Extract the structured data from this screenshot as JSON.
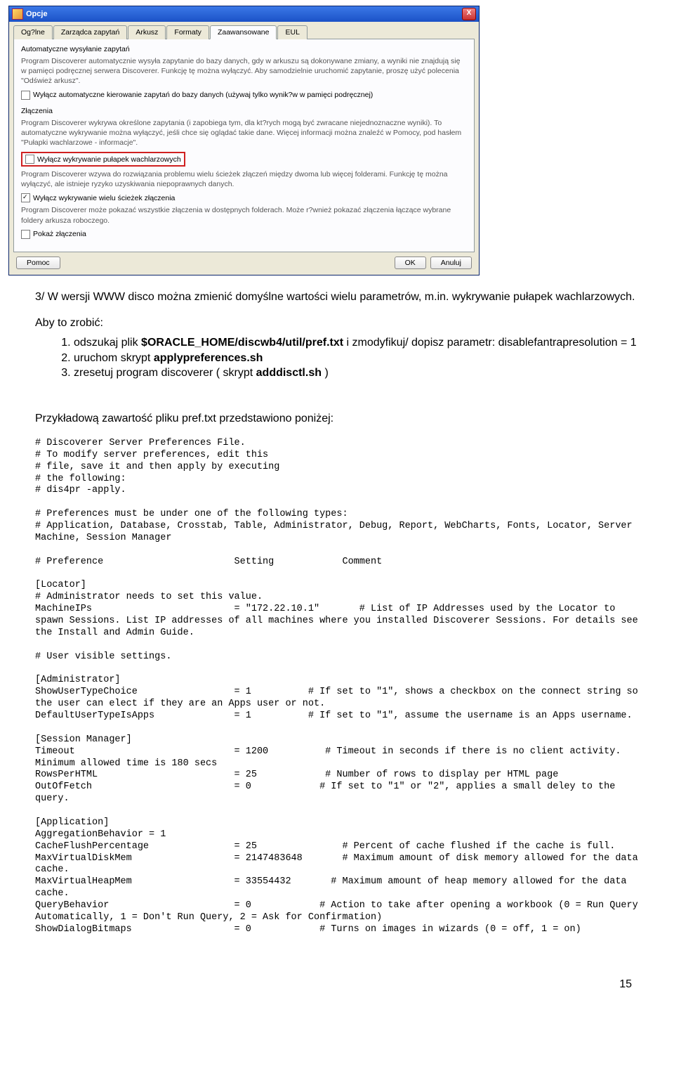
{
  "dialog": {
    "title": "Opcje",
    "tabs": [
      "Og?lne",
      "Zarządca zapytań",
      "Arkusz",
      "Formaty",
      "Zaawansowane",
      "EUL"
    ],
    "active_tab": 4,
    "group1_title": "Automatyczne wysyłanie zapytań",
    "group1_desc": "Program Discoverer automatycznie wysyła zapytanie do bazy danych, gdy w arkuszu są dokonywane zmiany, a wyniki nie znajdują się w pamięci podręcznej serwera Discoverer. Funkcję tę można wyłączyć. Aby samodzielnie uruchomić zapytanie, proszę użyć polecenia \"Odśwież arkusz\".",
    "chk1_label": "Wyłącz automatyczne kierowanie zapytań do bazy danych (używaj tylko wynik?w w pamięci podręcznej)",
    "group2_title": "Złączenia",
    "group2_desc1": "Program Discoverer wykrywa określone zapytania (i zapobiega tym, dla kt?rych mogą być zwracane niejednoznaczne wyniki). To automatyczne wykrywanie można wyłączyć, jeśli chce się oglądać takie dane. Więcej informacji można znaleźć w Pomocy, pod hasłem \"Pułapki wachlarzowe - informacje\".",
    "chk2_label": "Wyłącz wykrywanie pułapek wachlarzowych",
    "group2_desc2": "Program Discoverer wzywa do rozwiązania problemu wielu ścieżek złączeń między dwoma lub więcej folderami. Funkcję tę można wyłączyć, ale istnieje ryzyko uzyskiwania niepoprawnych danych.",
    "chk3_label": "Wyłącz wykrywanie wielu ścieżek złączenia",
    "group2_desc3": "Program Discoverer może pokazać wszystkie złączenia w dostępnych folderach. Może r?wnież pokazać złączenia łączące wybrane foldery arkusza roboczego.",
    "chk4_label": "Pokaż złączenia",
    "btn_help": "Pomoc",
    "btn_ok": "OK",
    "btn_cancel": "Anuluj"
  },
  "doc": {
    "p1": "3/ W wersji WWW disco można zmienić domyślne wartości wielu parametrów, m.in. wykrywanie pułapek wachlarzowych.",
    "p2": "Aby to zrobić:",
    "li1a": "odszukaj plik ",
    "li1b": "$ORACLE_HOME/discwb4/util/pref.txt",
    "li1c": " i zmodyfikuj/ dopisz parametr: disablefantrapresolution = 1",
    "li2a": "uruchom skrypt ",
    "li2b": "applypreferences.sh",
    "li3a": "zresetuj program discoverer ( skrypt ",
    "li3b": "adddisctl.sh",
    "li3c": " )",
    "p3": "Przykładową zawartość pliku pref.txt przedstawiono poniżej:",
    "pre": "# Discoverer Server Preferences File.\n# To modify server preferences, edit this\n# file, save it and then apply by executing\n# the following:\n# dis4pr -apply.\n\n# Preferences must be under one of the following types:\n# Application, Database, Crosstab, Table, Administrator, Debug, Report, WebCharts, Fonts, Locator, Server Machine, Session Manager\n\n# Preference                       Setting            Comment\n\n[Locator]\n# Administrator needs to set this value.\nMachineIPs                         = \"172.22.10.1\"       # List of IP Addresses used by the Locator to spawn Sessions. List IP addresses of all machines where you installed Discoverer Sessions. For details see the Install and Admin Guide.\n\n# User visible settings.\n\n[Administrator]\nShowUserTypeChoice                 = 1          # If set to \"1\", shows a checkbox on the connect string so the user can elect if they are an Apps user or not.\nDefaultUserTypeIsApps              = 1          # If set to \"1\", assume the username is an Apps username.\n\n[Session Manager]\nTimeout                            = 1200          # Timeout in seconds if there is no client activity. Minimum allowed time is 180 secs\nRowsPerHTML                        = 25            # Number of rows to display per HTML page\nOutOfFetch                         = 0            # If set to \"1\" or \"2\", applies a small deley to the query.\n\n[Application]\nAggregationBehavior = 1\nCacheFlushPercentage               = 25               # Percent of cache flushed if the cache is full.\nMaxVirtualDiskMem                  = 2147483648       # Maximum amount of disk memory allowed for the data cache.\nMaxVirtualHeapMem                  = 33554432       # Maximum amount of heap memory allowed for the data cache.\nQueryBehavior                      = 0            # Action to take after opening a workbook (0 = Run Query Automatically, 1 = Don't Run Query, 2 = Ask for Confirmation)\nShowDialogBitmaps                  = 0            # Turns on images in wizards (0 = off, 1 = on)"
  },
  "page_number": "15"
}
